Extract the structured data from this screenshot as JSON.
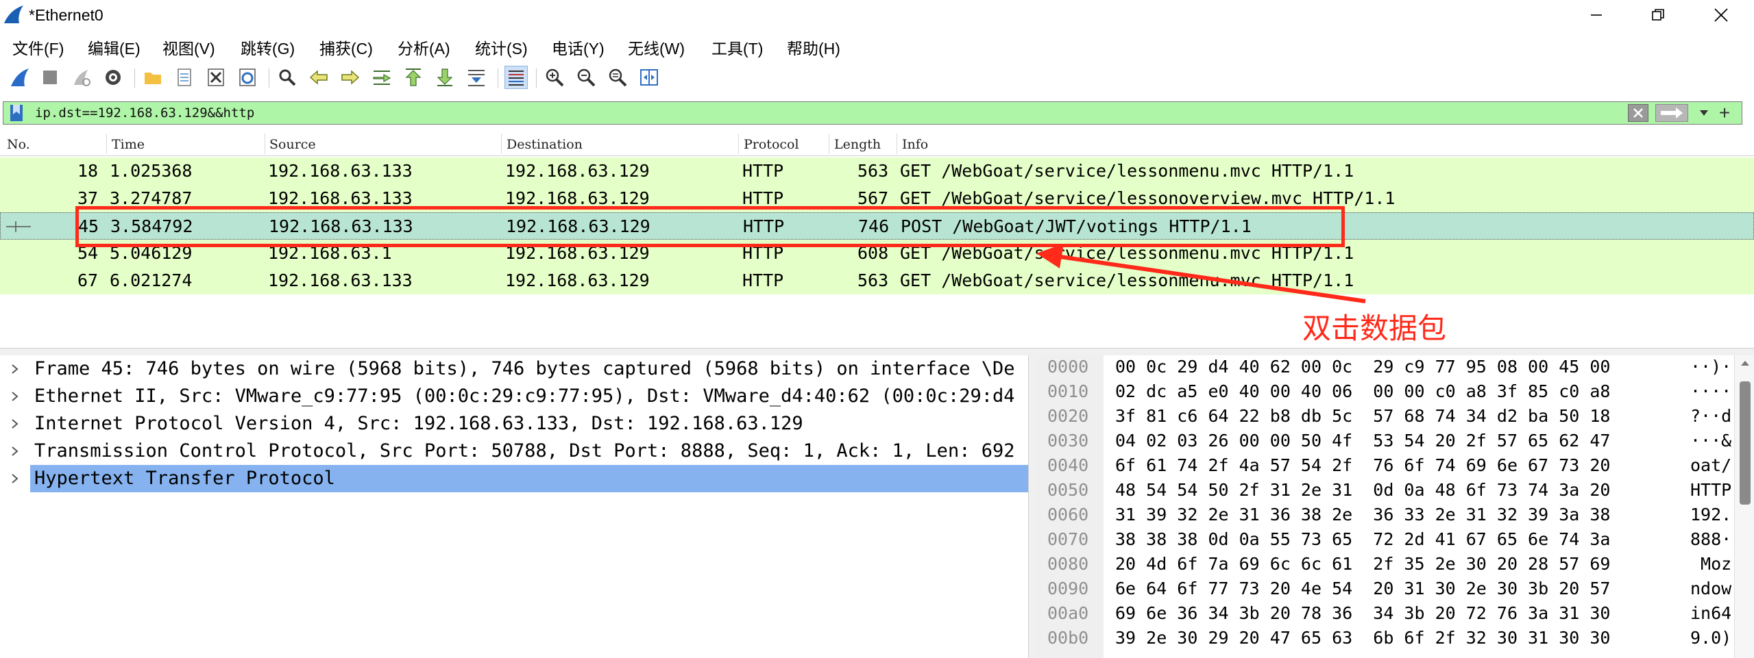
{
  "window": {
    "title": "*Ethernet0"
  },
  "menu": [
    "文件(F)",
    "编辑(E)",
    "视图(V)",
    "跳转(G)",
    "捕获(C)",
    "分析(A)",
    "统计(S)",
    "电话(Y)",
    "无线(W)",
    "工具(T)",
    "帮助(H)"
  ],
  "filter": {
    "text": "ip.dst==192.168.63.129&&http",
    "add_symbol": "+"
  },
  "packet_list": {
    "columns": [
      "No.",
      "Time",
      "Source",
      "Destination",
      "Protocol",
      "Length",
      "Info"
    ],
    "rows": [
      {
        "no": "18",
        "time": "1.025368",
        "src": "192.168.63.133",
        "dst": "192.168.63.129",
        "proto": "HTTP",
        "len": "563",
        "info": "GET /WebGoat/service/lessonmenu.mvc HTTP/1.1"
      },
      {
        "no": "37",
        "time": "3.274787",
        "src": "192.168.63.133",
        "dst": "192.168.63.129",
        "proto": "HTTP",
        "len": "567",
        "info": "GET /WebGoat/service/lessonoverview.mvc HTTP/1.1"
      },
      {
        "no": "45",
        "time": "3.584792",
        "src": "192.168.63.133",
        "dst": "192.168.63.129",
        "proto": "HTTP",
        "len": "746",
        "info": "POST /WebGoat/JWT/votings HTTP/1.1"
      },
      {
        "no": "54",
        "time": "5.046129",
        "src": "192.168.63.1",
        "dst": "192.168.63.129",
        "proto": "HTTP",
        "len": "608",
        "info": "GET /WebGoat/service/lessonmenu.mvc HTTP/1.1"
      },
      {
        "no": "67",
        "time": "6.021274",
        "src": "192.168.63.133",
        "dst": "192.168.63.129",
        "proto": "HTTP",
        "len": "563",
        "info": "GET /WebGoat/service/lessonmenu.mvc HTTP/1.1"
      }
    ],
    "selected_index": 2
  },
  "annotation": {
    "text": "双击数据包",
    "color": "#ff2a1a"
  },
  "details": [
    "Frame 45: 746 bytes on wire (5968 bits), 746 bytes captured (5968 bits) on interface \\De",
    "Ethernet II, Src: VMware_c9:77:95 (00:0c:29:c9:77:95), Dst: VMware_d4:40:62 (00:0c:29:d4",
    "Internet Protocol Version 4, Src: 192.168.63.133, Dst: 192.168.63.129",
    "Transmission Control Protocol, Src Port: 50788, Dst Port: 8888, Seq: 1, Ack: 1, Len: 692",
    "Hypertext Transfer Protocol"
  ],
  "hex": [
    {
      "off": "0000",
      "bytes": "00 0c 29 d4 40 62 00 0c  29 c9 77 95 08 00 45 00",
      "ascii": "··)·"
    },
    {
      "off": "0010",
      "bytes": "02 dc a5 e0 40 00 40 06  00 00 c0 a8 3f 85 c0 a8",
      "ascii": "····"
    },
    {
      "off": "0020",
      "bytes": "3f 81 c6 64 22 b8 db 5c  57 68 74 34 d2 ba 50 18",
      "ascii": "?··d"
    },
    {
      "off": "0030",
      "bytes": "04 02 03 26 00 00 50 4f  53 54 20 2f 57 65 62 47",
      "ascii": "···&"
    },
    {
      "off": "0040",
      "bytes": "6f 61 74 2f 4a 57 54 2f  76 6f 74 69 6e 67 73 20",
      "ascii": "oat/"
    },
    {
      "off": "0050",
      "bytes": "48 54 54 50 2f 31 2e 31  0d 0a 48 6f 73 74 3a 20",
      "ascii": "HTTP"
    },
    {
      "off": "0060",
      "bytes": "31 39 32 2e 31 36 38 2e  36 33 2e 31 32 39 3a 38",
      "ascii": "192."
    },
    {
      "off": "0070",
      "bytes": "38 38 38 0d 0a 55 73 65  72 2d 41 67 65 6e 74 3a",
      "ascii": "888·"
    },
    {
      "off": "0080",
      "bytes": "20 4d 6f 7a 69 6c 6c 61  2f 35 2e 30 20 28 57 69",
      "ascii": " Moz"
    },
    {
      "off": "0090",
      "bytes": "6e 64 6f 77 73 20 4e 54  20 31 30 2e 30 3b 20 57",
      "ascii": "ndow"
    },
    {
      "off": "00a0",
      "bytes": "69 6e 36 34 3b 20 78 36  34 3b 20 72 76 3a 31 30",
      "ascii": "in64"
    },
    {
      "off": "00b0",
      "bytes": "39 2e 30 29 20 47 65 63  6b 6f 2f 32 30 31 30 30",
      "ascii": "9.0)"
    }
  ]
}
